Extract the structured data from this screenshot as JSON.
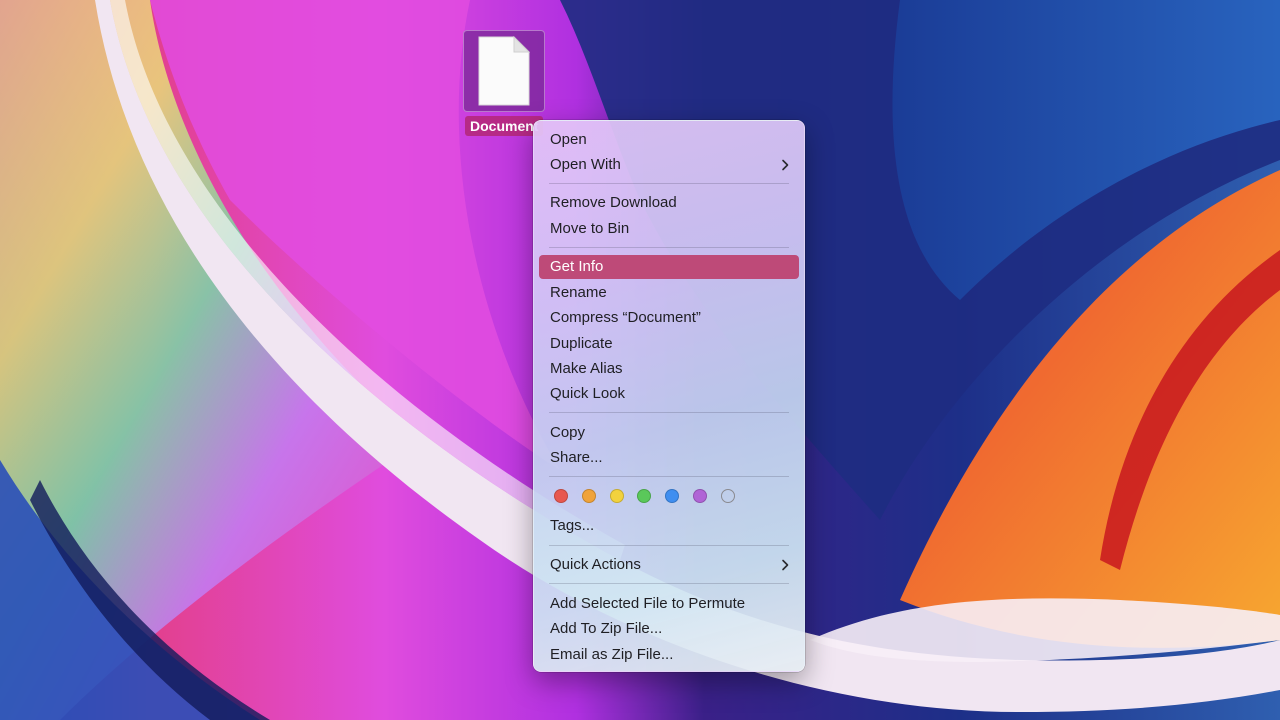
{
  "desktop": {
    "file_icon": {
      "icon": "document-file-icon",
      "label": "Document"
    }
  },
  "context_menu": {
    "sections": [
      {
        "items": [
          {
            "label": "Open"
          },
          {
            "label": "Open With",
            "has_submenu": true
          }
        ]
      },
      {
        "items": [
          {
            "label": "Remove Download"
          },
          {
            "label": "Move to Bin"
          }
        ]
      },
      {
        "items": [
          {
            "label": "Get Info",
            "selected": true
          },
          {
            "label": "Rename"
          },
          {
            "label": "Compress “Document”"
          },
          {
            "label": "Duplicate"
          },
          {
            "label": "Make Alias"
          },
          {
            "label": "Quick Look"
          }
        ]
      },
      {
        "items": [
          {
            "label": "Copy"
          },
          {
            "label": "Share..."
          }
        ]
      },
      {
        "tags": {
          "colors": [
            {
              "name": "red",
              "hex": "#e8584f"
            },
            {
              "name": "orange",
              "hex": "#f0a33a"
            },
            {
              "name": "yellow",
              "hex": "#f2d23e"
            },
            {
              "name": "green",
              "hex": "#5ac85a"
            },
            {
              "name": "blue",
              "hex": "#3f8ef0"
            },
            {
              "name": "purple",
              "hex": "#b064d6"
            },
            {
              "name": "none",
              "hex": "transparent"
            }
          ],
          "label": "Tags..."
        }
      },
      {
        "items": [
          {
            "label": "Quick Actions",
            "has_submenu": true
          }
        ]
      },
      {
        "items": [
          {
            "label": "Add Selected File to Permute"
          },
          {
            "label": "Add To Zip File..."
          },
          {
            "label": "Email as Zip File..."
          }
        ]
      }
    ],
    "highlight_color": "#be4a78"
  }
}
